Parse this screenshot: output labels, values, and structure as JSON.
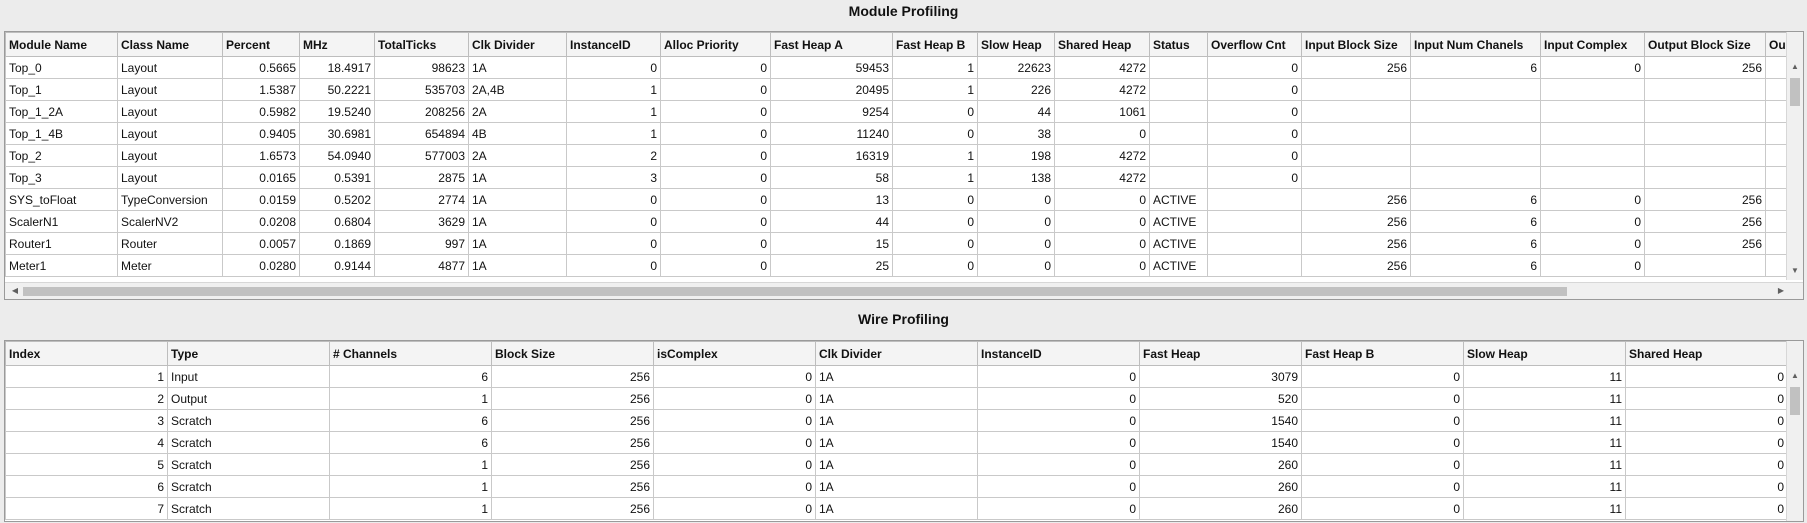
{
  "module_profiling": {
    "title": "Module Profiling",
    "columns": [
      "Module Name",
      "Class Name",
      "Percent",
      "MHz",
      "TotalTicks",
      "Clk Divider",
      "InstanceID",
      "Alloc Priority",
      "Fast Heap A",
      "Fast Heap B",
      "Slow Heap",
      "Shared Heap",
      "Status",
      "Overflow Cnt",
      "Input Block Size",
      "Input Num Chanels",
      "Input Complex",
      "Output Block Size",
      "Ou"
    ],
    "rows": [
      [
        "Top_0",
        "Layout",
        "0.5665",
        "18.4917",
        "98623",
        "1A",
        "0",
        "0",
        "59453",
        "1",
        "22623",
        "4272",
        "",
        "0",
        "256",
        "6",
        "0",
        "256",
        ""
      ],
      [
        "Top_1",
        "Layout",
        "1.5387",
        "50.2221",
        "535703",
        "2A,4B",
        "1",
        "0",
        "20495",
        "1",
        "226",
        "4272",
        "",
        "0",
        "",
        "",
        "",
        "",
        ""
      ],
      [
        "Top_1_2A",
        "Layout",
        "0.5982",
        "19.5240",
        "208256",
        "2A",
        "1",
        "0",
        "9254",
        "0",
        "44",
        "1061",
        "",
        "0",
        "",
        "",
        "",
        "",
        ""
      ],
      [
        "Top_1_4B",
        "Layout",
        "0.9405",
        "30.6981",
        "654894",
        "4B",
        "1",
        "0",
        "11240",
        "0",
        "38",
        "0",
        "",
        "0",
        "",
        "",
        "",
        "",
        ""
      ],
      [
        "Top_2",
        "Layout",
        "1.6573",
        "54.0940",
        "577003",
        "2A",
        "2",
        "0",
        "16319",
        "1",
        "198",
        "4272",
        "",
        "0",
        "",
        "",
        "",
        "",
        ""
      ],
      [
        "Top_3",
        "Layout",
        "0.0165",
        "0.5391",
        "2875",
        "1A",
        "3",
        "0",
        "58",
        "1",
        "138",
        "4272",
        "",
        "0",
        "",
        "",
        "",
        "",
        ""
      ],
      [
        "SYS_toFloat",
        "TypeConversion",
        "0.0159",
        "0.5202",
        "2774",
        "1A",
        "0",
        "0",
        "13",
        "0",
        "0",
        "0",
        "ACTIVE",
        "",
        "256",
        "6",
        "0",
        "256",
        ""
      ],
      [
        "ScalerN1",
        "ScalerNV2",
        "0.0208",
        "0.6804",
        "3629",
        "1A",
        "0",
        "0",
        "44",
        "0",
        "0",
        "0",
        "ACTIVE",
        "",
        "256",
        "6",
        "0",
        "256",
        ""
      ],
      [
        "Router1",
        "Router",
        "0.0057",
        "0.1869",
        "997",
        "1A",
        "0",
        "0",
        "15",
        "0",
        "0",
        "0",
        "ACTIVE",
        "",
        "256",
        "6",
        "0",
        "256",
        ""
      ],
      [
        "Meter1",
        "Meter",
        "0.0280",
        "0.9144",
        "4877",
        "1A",
        "0",
        "0",
        "25",
        "0",
        "0",
        "0",
        "ACTIVE",
        "",
        "256",
        "6",
        "0",
        "",
        ""
      ]
    ]
  },
  "wire_profiling": {
    "title": "Wire Profiling",
    "columns": [
      "Index",
      "Type",
      "# Channels",
      "Block Size",
      "isComplex",
      "Clk Divider",
      "InstanceID",
      "Fast Heap",
      "Fast Heap B",
      "Slow Heap",
      "Shared Heap"
    ],
    "rows": [
      [
        "1",
        "Input",
        "6",
        "256",
        "0",
        "1A",
        "0",
        "3079",
        "0",
        "11",
        "0"
      ],
      [
        "2",
        "Output",
        "1",
        "256",
        "0",
        "1A",
        "0",
        "520",
        "0",
        "11",
        "0"
      ],
      [
        "3",
        "Scratch",
        "6",
        "256",
        "0",
        "1A",
        "0",
        "1540",
        "0",
        "11",
        "0"
      ],
      [
        "4",
        "Scratch",
        "6",
        "256",
        "0",
        "1A",
        "0",
        "1540",
        "0",
        "11",
        "0"
      ],
      [
        "5",
        "Scratch",
        "1",
        "256",
        "0",
        "1A",
        "0",
        "260",
        "0",
        "11",
        "0"
      ],
      [
        "6",
        "Scratch",
        "1",
        "256",
        "0",
        "1A",
        "0",
        "260",
        "0",
        "11",
        "0"
      ],
      [
        "7",
        "Scratch",
        "1",
        "256",
        "0",
        "1A",
        "0",
        "260",
        "0",
        "11",
        "0"
      ]
    ]
  },
  "icons": {
    "scroll_up": "▲",
    "scroll_down": "▼",
    "scroll_left": "◀",
    "scroll_right": "▶"
  }
}
